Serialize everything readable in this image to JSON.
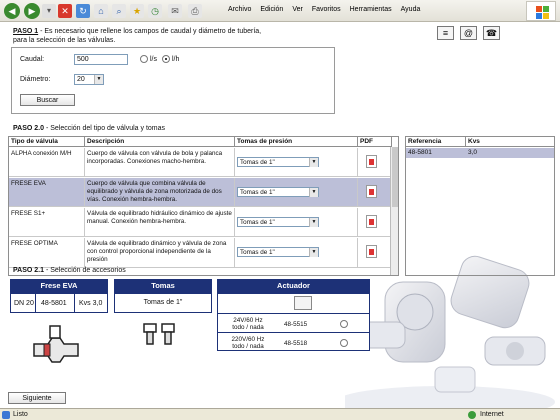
{
  "browser": {
    "menu": [
      "Archivo",
      "Edición",
      "Ver",
      "Favoritos",
      "Herramientas",
      "Ayuda"
    ]
  },
  "paso1": {
    "title": "PASO 1",
    "text": " - Es necesario que rellene los campos de caudal y diámetro de tubería, para la selección de las válvulas.",
    "caudal_label": "Caudal:",
    "caudal_value": "500",
    "unit_ls": "l/s",
    "unit_lh": "l/h",
    "diametro_label": "Diámetro:",
    "diametro_value": "20",
    "search_button": "Buscar"
  },
  "paso2": {
    "title": "PASO 2.0",
    "subtitle": " - Selección del tipo de válvula y tomas",
    "columns": [
      "Tipo de válvula",
      "Descripción",
      "Tomas de presión",
      "PDF"
    ],
    "rows": [
      {
        "tipo": "ALPHA conexión M/H",
        "desc": "Cuerpo de válvula con válvula de bola y palanca incorporadas. Conexiones macho-hembra.",
        "tomas": "Tomas de 1\""
      },
      {
        "tipo": "FRESE EVA",
        "desc": "Cuerpo de válvula que combina válvula de equilibrado y válvula de zona motorizada de dos vías. Conexión hembra-hembra.",
        "tomas": "Tomas de 1\""
      },
      {
        "tipo": "FRESE S1+",
        "desc": "Válvula de equilibrado hidráulico dinámico de ajuste manual. Conexión hembra-hembra.",
        "tomas": "Tomas de 1\""
      },
      {
        "tipo": "FRESE OPTIMA",
        "desc": "Válvula de equilibrado dinámico y válvula de zona con control proporcional independiente de la presión",
        "tomas": "Tomas de 1\""
      }
    ],
    "ref_columns": [
      "Referencia",
      "Kvs"
    ],
    "ref_row": {
      "ref": "48-5801",
      "kvs": "3,0"
    }
  },
  "paso21": {
    "title": "PASO 2.1",
    "subtitle": " - Selección de accesorios",
    "eva_head": "Frese EVA",
    "eva_dn": "DN 20",
    "eva_ref": "48-5801",
    "eva_kvs": "Kvs 3,0",
    "tomas_head": "Tomas",
    "tomas_value": "Tomas de 1\"",
    "actuador_head": "Actuador",
    "act_rows": [
      {
        "spec": "24V/60 Hz todo / nada",
        "ref": "48-5515"
      },
      {
        "spec": "220V/60 Hz todo / nada",
        "ref": "48-5518"
      }
    ]
  },
  "nav": {
    "next": "Siguiente"
  },
  "status": {
    "left": "Listo",
    "right": "Internet"
  }
}
